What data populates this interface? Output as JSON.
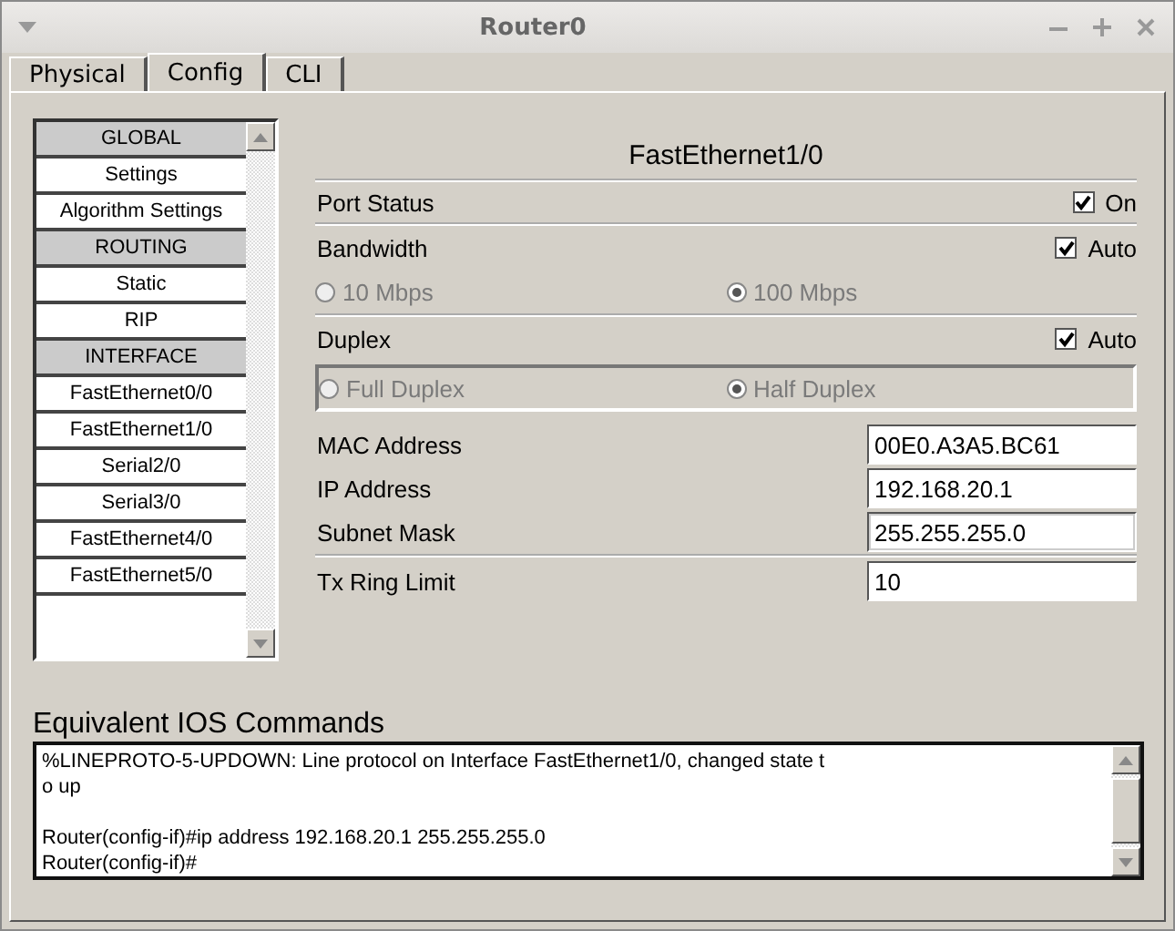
{
  "window": {
    "title": "Router0"
  },
  "tabs": [
    {
      "label": "Physical",
      "selected": false
    },
    {
      "label": "Config",
      "selected": true
    },
    {
      "label": "CLI",
      "selected": false
    }
  ],
  "sidebar": {
    "items": [
      {
        "kind": "header",
        "label": "GLOBAL"
      },
      {
        "kind": "item",
        "label": "Settings"
      },
      {
        "kind": "item",
        "label": "Algorithm Settings"
      },
      {
        "kind": "header",
        "label": "ROUTING"
      },
      {
        "kind": "item",
        "label": "Static"
      },
      {
        "kind": "item",
        "label": "RIP"
      },
      {
        "kind": "header",
        "label": "INTERFACE"
      },
      {
        "kind": "item",
        "label": "FastEthernet0/0"
      },
      {
        "kind": "item",
        "label": "FastEthernet1/0"
      },
      {
        "kind": "item",
        "label": "Serial2/0"
      },
      {
        "kind": "item",
        "label": "Serial3/0"
      },
      {
        "kind": "item",
        "label": "FastEthernet4/0"
      },
      {
        "kind": "item",
        "label": "FastEthernet5/0"
      }
    ]
  },
  "panel": {
    "title": "FastEthernet1/0",
    "port_status": {
      "label": "Port Status",
      "checkbox_label": "On",
      "checked": true
    },
    "bandwidth": {
      "label": "Bandwidth",
      "checkbox_label": "Auto",
      "checked": true,
      "options": [
        {
          "label": "10 Mbps",
          "selected": false,
          "disabled": true
        },
        {
          "label": "100 Mbps",
          "selected": true,
          "disabled": true
        }
      ]
    },
    "duplex": {
      "label": "Duplex",
      "checkbox_label": "Auto",
      "checked": true,
      "options": [
        {
          "label": "Full Duplex",
          "selected": false,
          "disabled": true
        },
        {
          "label": "Half Duplex",
          "selected": true,
          "disabled": true
        }
      ]
    },
    "fields": [
      {
        "label": "MAC Address",
        "value": "00E0.A3A5.BC61",
        "focused": false
      },
      {
        "label": "IP Address",
        "value": "192.168.20.1",
        "focused": false
      },
      {
        "label": "Subnet Mask",
        "value": "255.255.255.0",
        "focused": true
      }
    ],
    "tx_ring": {
      "label": "Tx Ring Limit",
      "value": "10"
    }
  },
  "console": {
    "title": "Equivalent IOS Commands",
    "lines": [
      {
        "text": "%LINEPROTO-5-UPDOWN: Line protocol on Interface FastEthernet1/0, changed state t",
        "spaced": false
      },
      {
        "text": "o up",
        "spaced": false
      },
      {
        "text": "Router(config-if)#ip address 192.168.20.1 255.255.255.0",
        "spaced": true
      },
      {
        "text": "Router(config-if)#",
        "spaced": false
      }
    ]
  }
}
